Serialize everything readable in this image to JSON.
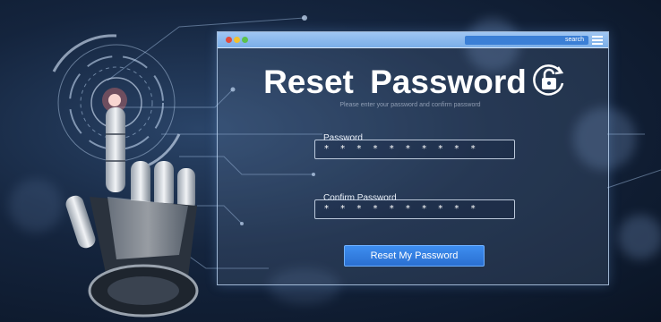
{
  "window": {
    "search_label": "search"
  },
  "form": {
    "title": "Reset Password",
    "subtitle": "Please enter your password and confirm password",
    "password_label": "Password",
    "password_value": "* * * * * * * * * *",
    "confirm_label": "Confirm Password",
    "confirm_value": "* * * * * * * * * *",
    "submit_label": "Reset My Password"
  },
  "colors": {
    "accent": "#2f7fe0",
    "titlebar": "#8fbcf0"
  }
}
